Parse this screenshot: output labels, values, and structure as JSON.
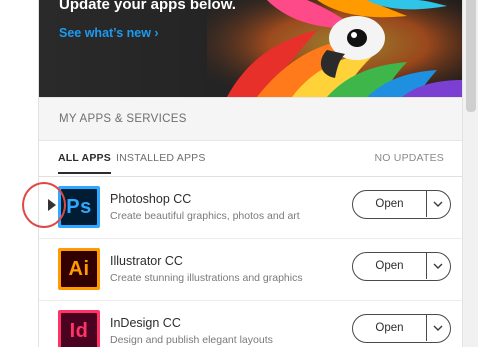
{
  "banner": {
    "title": "Update your apps below.",
    "link": "See what’s new ›"
  },
  "section": {
    "title": "MY APPS & SERVICES"
  },
  "tabs": {
    "all": "ALL APPS",
    "installed": "INSTALLED APPS",
    "no_updates": "NO UPDATES"
  },
  "apps": [
    {
      "icon_label": "Ps",
      "icon_name": "photoshop-icon",
      "name": "Photoshop CC",
      "description": "Create beautiful graphics, photos and art",
      "button": "Open",
      "color_text": "#31a8ff",
      "color_bg": "#001d34"
    },
    {
      "icon_label": "Ai",
      "icon_name": "illustrator-icon",
      "name": "Illustrator CC",
      "description": "Create stunning illustrations and graphics",
      "button": "Open",
      "color_text": "#ff9a00",
      "color_bg": "#330000"
    },
    {
      "icon_label": "Id",
      "icon_name": "indesign-icon",
      "name": "InDesign CC",
      "description": "Design and publish elegant layouts",
      "button": "Open",
      "color_text": "#ff3366",
      "color_bg": "#49021f"
    }
  ],
  "colors": {
    "link": "#1d9bf0",
    "highlight": "#e04848"
  }
}
